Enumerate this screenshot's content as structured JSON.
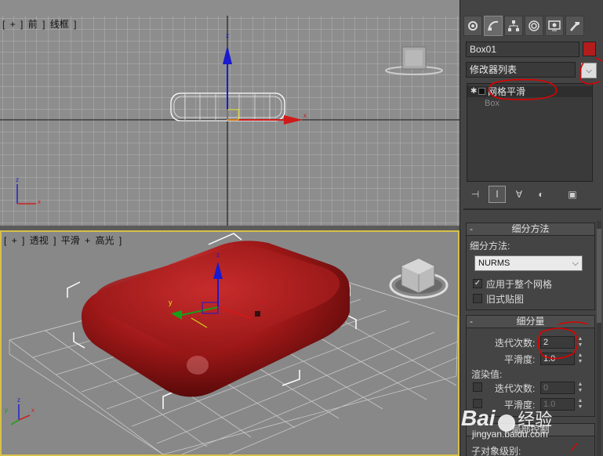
{
  "viewport_front": {
    "label_parts": [
      "[",
      "+",
      "]",
      "前",
      "]",
      "线框",
      "]"
    ]
  },
  "viewport_persp": {
    "label_parts": [
      "[",
      "+",
      "]",
      "透视",
      "]",
      "平滑",
      "+",
      "高光",
      "]"
    ]
  },
  "axes": {
    "x": "x",
    "y": "y",
    "z": "z"
  },
  "command_panel": {
    "tabs": [
      "create-icon",
      "modify-icon",
      "hierarchy-icon",
      "motion-icon",
      "display-icon",
      "utilities-icon"
    ],
    "object_name": "Box01",
    "object_color": "#b31c1c",
    "modifier_list_label": "修改器列表",
    "modifier_list_arrow": "⌵",
    "stack": [
      {
        "label": "网格平滑",
        "selected": true
      },
      {
        "label": "Box",
        "selected": false
      }
    ],
    "stack_buttons": [
      "pin-icon",
      "show-end-result-icon",
      "make-unique-icon",
      "remove-modifier-icon",
      "configure-sets-icon"
    ]
  },
  "subdivision_method": {
    "title": "细分方法",
    "minus": "-",
    "method_label": "细分方法:",
    "method_value": "NURMS",
    "apply_whole_mesh_label": "应用于整个网格",
    "apply_whole_mesh_checked": true,
    "legacy_mapping_label": "旧式贴图",
    "legacy_mapping_checked": false
  },
  "subdivision_amount": {
    "title": "细分量",
    "minus": "-",
    "iterations_label": "迭代次数:",
    "iterations_value": "2",
    "smoothness_label": "平滑度:",
    "smoothness_value": "1.0",
    "render_values_label": "渲染值:",
    "render_iterations_label": "迭代次数:",
    "render_iterations_value": "0",
    "render_smoothness_label": "平滑度:",
    "render_smoothness_value": "1.0"
  },
  "bottom": {
    "partial_rollout_title": "局部控制",
    "partial_text": "子对象级别:"
  },
  "watermark": {
    "brand": "Bai",
    "brand_suffix": "经验",
    "url": "jingyan.baidu.com"
  },
  "colors": {
    "viewport_bg": "#8d8d8d",
    "active_viewport_border": "#d6c04a",
    "object_red": "#a01818",
    "annotation_red": "#e00000"
  }
}
